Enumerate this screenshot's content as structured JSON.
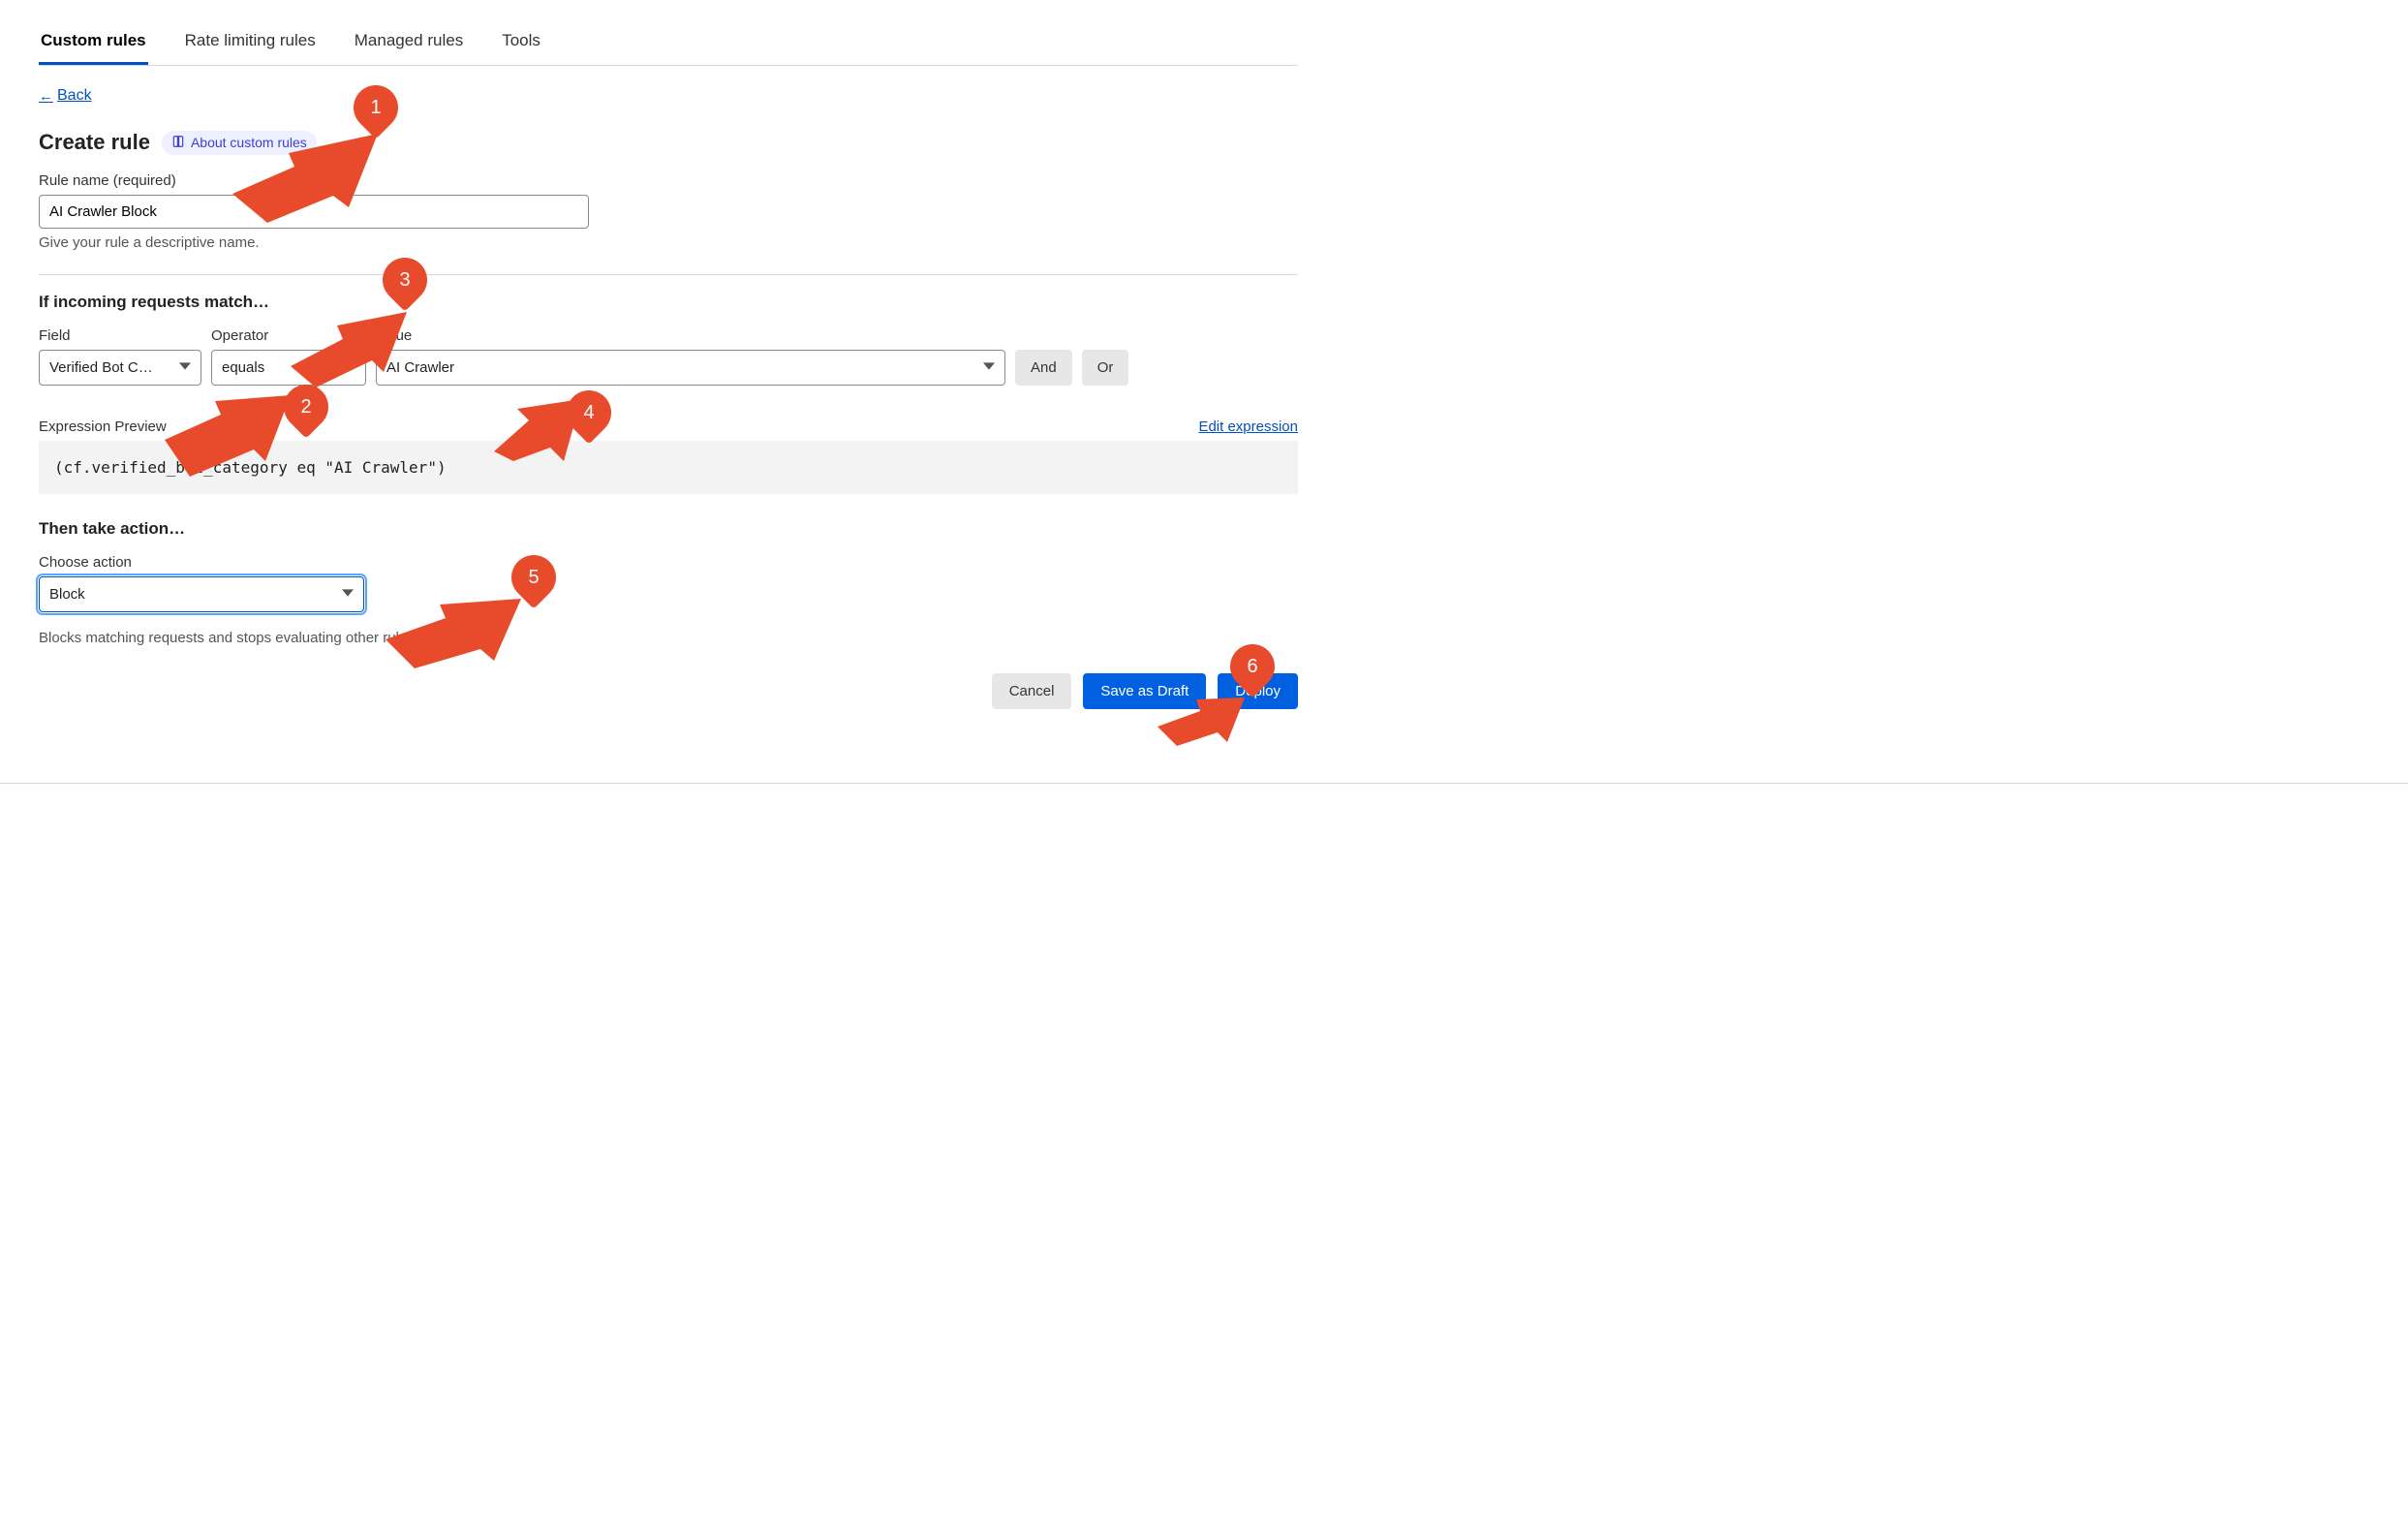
{
  "tabs": [
    "Custom rules",
    "Rate limiting rules",
    "Managed rules",
    "Tools"
  ],
  "active_tab": "Custom rules",
  "back_label": "Back",
  "page_title": "Create rule",
  "about_badge": "About custom rules",
  "rule_name": {
    "label": "Rule name (required)",
    "value": "AI Crawler Block",
    "hint": "Give your rule a descriptive name."
  },
  "match_heading": "If incoming requests match…",
  "condition": {
    "field_label": "Field",
    "operator_label": "Operator",
    "value_label": "Value",
    "field_value": "Verified Bot C…",
    "operator_value": "equals",
    "value_value": "AI Crawler",
    "and_btn": "And",
    "or_btn": "Or"
  },
  "expression": {
    "label": "Expression Preview",
    "edit_link": "Edit expression",
    "code": "(cf.verified_bot_category eq \"AI Crawler\")"
  },
  "action": {
    "heading": "Then take action…",
    "label": "Choose action",
    "value": "Block",
    "hint": "Blocks matching requests and stops evaluating other rules"
  },
  "footer": {
    "cancel": "Cancel",
    "draft": "Save as Draft",
    "deploy": "Deploy"
  },
  "markers": [
    "1",
    "2",
    "3",
    "4",
    "5",
    "6"
  ]
}
